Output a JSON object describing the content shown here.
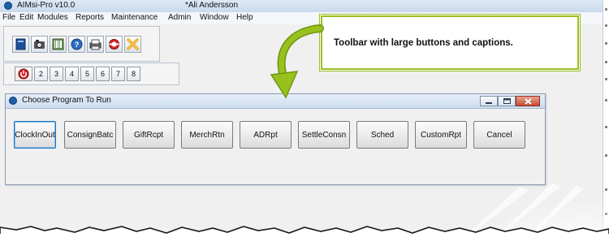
{
  "app": {
    "title": "AIMsi-Pro v10.0",
    "user": "*Ali Andersson"
  },
  "menubar": {
    "items": [
      "File",
      "Edit",
      "Modules",
      "Reports",
      "Maintenance",
      "Admin",
      "Window",
      "Help"
    ]
  },
  "toolbar_top": {
    "icons": [
      "notebook-icon",
      "camera-icon",
      "barcode-reader-icon",
      "help-icon",
      "printer-icon",
      "lifebuoy-icon",
      "exit-x-icon"
    ]
  },
  "toolbar_numbers": {
    "power_icon": "power-icon",
    "numbers": [
      "2",
      "3",
      "4",
      "5",
      "6",
      "7",
      "8"
    ]
  },
  "dialog": {
    "title": "Choose Program To Run",
    "buttons": [
      "ClockInOut",
      "ConsignBatc",
      "GiftRcpt",
      "MerchRtn",
      "ADRpt",
      "SettleConsn",
      "Sched",
      "CustomRpt",
      "Cancel"
    ],
    "focused_button": "ClockInOut"
  },
  "callout": {
    "text": "Toolbar with large buttons and captions.",
    "border_color": "#9bbf1f",
    "arrow_color": "#8bb418"
  }
}
